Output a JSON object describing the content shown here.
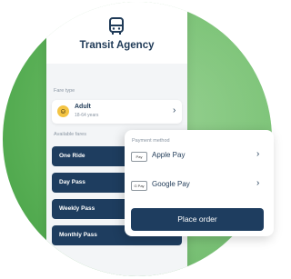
{
  "header": {
    "title": "Transit Agency"
  },
  "fare_type": {
    "section_label": "Fare type",
    "name": "Adult",
    "subtitle": "18-64 years",
    "chevron": "›"
  },
  "available_fares": {
    "section_label": "Available fares",
    "items": [
      {
        "label": "One Ride"
      },
      {
        "label": "Day Pass"
      },
      {
        "label": "Weekly Pass"
      },
      {
        "label": "Monthly Pass"
      }
    ]
  },
  "payment": {
    "section_label": "Payment method",
    "methods": [
      {
        "badge": "Pay",
        "label": "Apple Pay",
        "chevron": "›"
      },
      {
        "badge": "G Pay",
        "label": "Google Pay",
        "chevron": "›"
      }
    ],
    "place_order_label": "Place order"
  },
  "icons": {
    "header": "bus-icon",
    "fare_emoji": "smiley-face-icon"
  },
  "colors": {
    "primary": "#1e3d5f",
    "background_green": "#63b65e",
    "accent_yellow": "#f4c443"
  }
}
